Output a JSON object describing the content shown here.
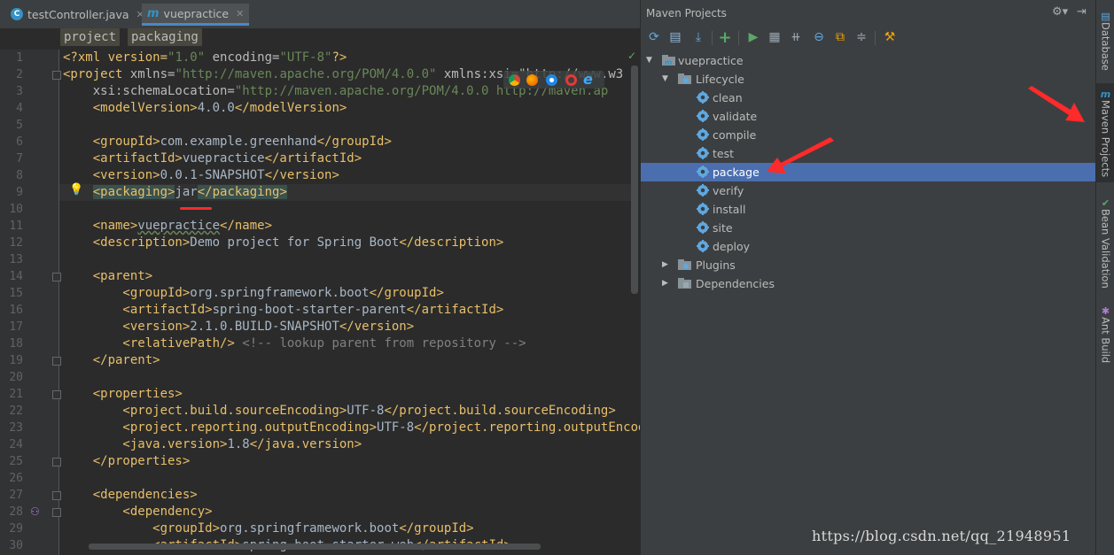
{
  "tabs": [
    {
      "label": "testController.java",
      "icon": "java-class-icon",
      "active": false
    },
    {
      "label": "vuepractice",
      "icon": "maven-icon",
      "active": true
    }
  ],
  "breadcrumb": [
    "project",
    "packaging"
  ],
  "editor": {
    "line_numbers": [
      "1",
      "2",
      "3",
      "4",
      "5",
      "6",
      "7",
      "8",
      "9",
      "10",
      "11",
      "12",
      "13",
      "14",
      "15",
      "16",
      "17",
      "18",
      "19",
      "20",
      "21",
      "22",
      "23",
      "24",
      "25",
      "26",
      "27",
      "28",
      "29",
      "30"
    ],
    "lines": {
      "l1": {
        "a": "<?xml version=",
        "b": "\"1.0\"",
        "c": " encoding=",
        "d": "\"UTF-8\"",
        "e": "?>"
      },
      "l2": {
        "a": "<project ",
        "b": "xmlns=",
        "c": "\"http://maven.apache.org/POM/4.0.0\"",
        "d": " xmlns:xsi=\"http://www.w3"
      },
      "l3": {
        "a": "    xsi:schemaLocation=",
        "b": "\"http://maven.apache.org/POM/4.0.0 http://maven.ap"
      },
      "l4": {
        "a": "    <modelVersion>",
        "b": "4.0.0",
        "c": "</modelVersion>"
      },
      "l6": {
        "a": "    <groupId>",
        "b": "com.example.greenhand",
        "c": "</groupId>"
      },
      "l7": {
        "a": "    <artifactId>",
        "b": "vuepractice",
        "c": "</artifactId>"
      },
      "l8": {
        "a": "    <version>",
        "b": "0.0.1-SNAPSHOT",
        "c": "</version>"
      },
      "l9": {
        "a": "<packaging>",
        "b": "jar",
        "c": "</packaging>"
      },
      "l11": {
        "a": "    <name>",
        "b": "vuepractice",
        "c": "</name>"
      },
      "l12": {
        "a": "    <description>",
        "b": "Demo project for Spring Boot",
        "c": "</description>"
      },
      "l14": {
        "a": "    <parent>"
      },
      "l15": {
        "a": "        <groupId>",
        "b": "org.springframework.boot",
        "c": "</groupId>"
      },
      "l16": {
        "a": "        <artifactId>",
        "b": "spring-boot-starter-parent",
        "c": "</artifactId>"
      },
      "l17": {
        "a": "        <version>",
        "b": "2.1.0.BUILD-SNAPSHOT",
        "c": "</version>"
      },
      "l18": {
        "a": "        <relativePath/>",
        "b": " <!-- lookup parent from repository -->"
      },
      "l19": {
        "a": "    </parent>"
      },
      "l21": {
        "a": "    <properties>"
      },
      "l22": {
        "a": "        <project.build.sourceEncoding>",
        "b": "UTF-8",
        "c": "</project.build.sourceEncoding>"
      },
      "l23": {
        "a": "        <project.reporting.outputEncoding>",
        "b": "UTF-8",
        "c": "</project.reporting.outputEncoding>"
      },
      "l24": {
        "a": "        <java.version>",
        "b": "1.8",
        "c": "</java.version>"
      },
      "l25": {
        "a": "    </properties>"
      },
      "l27": {
        "a": "    <dependencies>"
      },
      "l28": {
        "a": "        <dependency>"
      },
      "l29": {
        "a": "            <groupId>",
        "b": "org.springframework.boot",
        "c": "</groupId>"
      },
      "l30": {
        "a": "            <artifactId>",
        "b": "spring-boot-starter-web",
        "c": "</artifactId>"
      }
    }
  },
  "maven": {
    "title": "Maven Projects",
    "project": "vuepractice",
    "lifecycle_label": "Lifecycle",
    "phases": [
      "clean",
      "validate",
      "compile",
      "test",
      "package",
      "verify",
      "install",
      "site",
      "deploy"
    ],
    "selected_phase": "package",
    "plugins_label": "Plugins",
    "dependencies_label": "Dependencies"
  },
  "side_tabs": [
    "Database",
    "Maven Projects",
    "Bean Validation",
    "Ant Build"
  ],
  "watermark": "https://blog.csdn.net/qq_21948951",
  "colors": {
    "accent": "#4b6eaf",
    "annotation_red": "#ff2a2a",
    "tag": "#e8bf6a",
    "string": "#6a8759"
  }
}
